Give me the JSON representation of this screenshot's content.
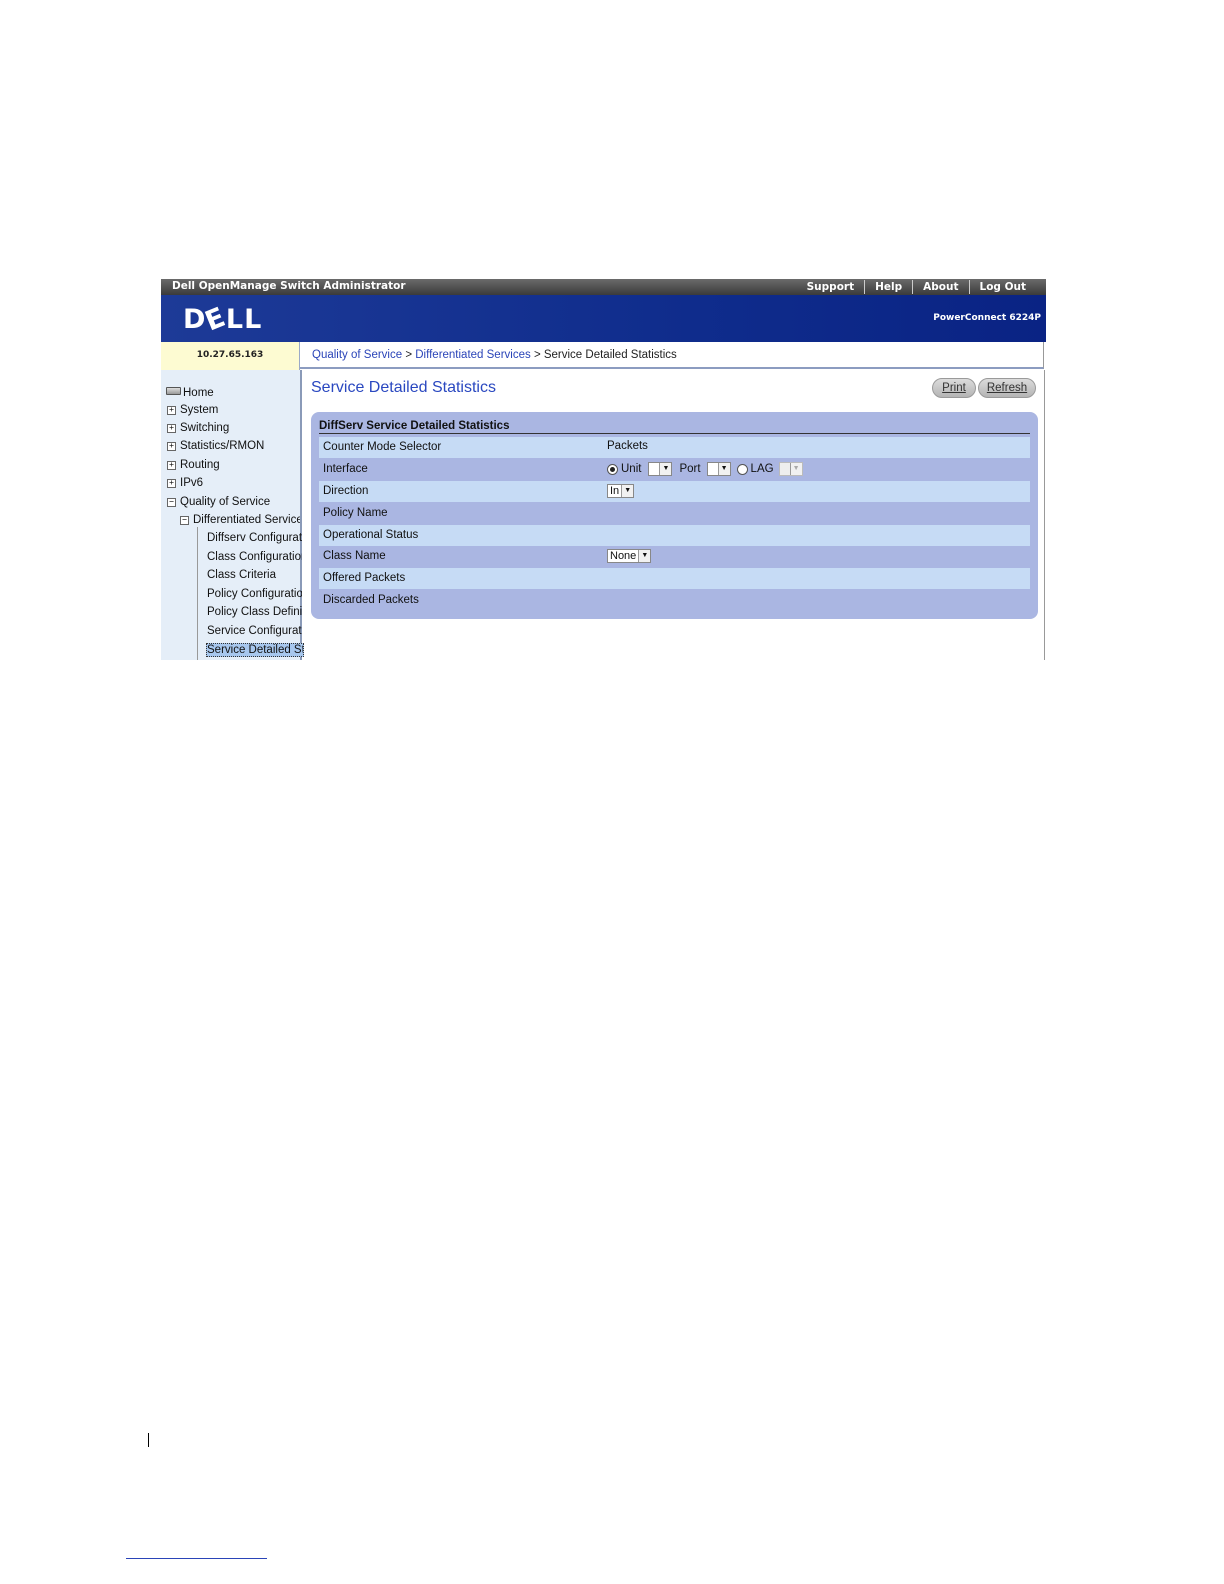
{
  "app": {
    "title": "Dell OpenManage Switch Administrator",
    "top_links": [
      "Support",
      "Help",
      "About",
      "Log Out"
    ],
    "logo": {
      "pre": "D",
      "e": "E",
      "post": "LL"
    },
    "product": "PowerConnect 6224P",
    "ip": "10.27.65.163"
  },
  "breadcrumb": {
    "items": [
      "Quality of Service",
      "Differentiated Services",
      "Service Detailed Statistics"
    ],
    "separator": ">"
  },
  "sidebar": {
    "home": "Home",
    "top_items": [
      "System",
      "Switching",
      "Statistics/RMON",
      "Routing",
      "IPv6"
    ],
    "qos": "Quality of Service",
    "diffserv": "Differentiated Services",
    "leaves": [
      "Diffserv Configuration",
      "Class Configuration",
      "Class Criteria",
      "Policy Configuration",
      "Policy Class Definition",
      "Service Configuration",
      "Service Detailed Statistics"
    ]
  },
  "main": {
    "page_title": "Service Detailed Statistics",
    "print_label": "Print",
    "refresh_label": "Refresh",
    "panel_title": "DiffServ Service Detailed Statistics",
    "rows": {
      "counter_mode": {
        "label": "Counter Mode Selector",
        "value": "Packets"
      },
      "interface": {
        "label": "Interface",
        "unit_label": "Unit",
        "port_label": "Port",
        "lag_label": "LAG",
        "unit_value": "",
        "port_value": "",
        "lag_value": ""
      },
      "direction": {
        "label": "Direction",
        "value": "In"
      },
      "policy_name": {
        "label": "Policy Name"
      },
      "operational_status": {
        "label": "Operational Status"
      },
      "class_name": {
        "label": "Class Name",
        "value": "None"
      },
      "offered_packets": {
        "label": "Offered Packets"
      },
      "discarded_packets": {
        "label": "Discarded Packets"
      }
    }
  },
  "colors": {
    "banner": "#0f2c8c",
    "link": "#2a44b8",
    "panel": "#aab6e2",
    "row_alt": "#c6dbf5",
    "sidebar": "#e5eef8"
  }
}
